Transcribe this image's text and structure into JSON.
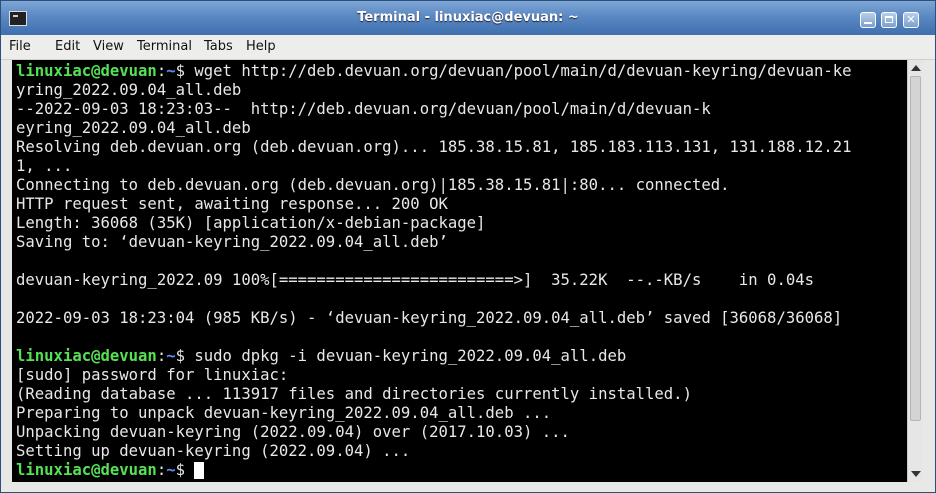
{
  "window": {
    "title": "Terminal - linuxiac@devuan: ~"
  },
  "menu": [
    "File",
    "Edit",
    "View",
    "Terminal",
    "Tabs",
    "Help"
  ],
  "colors": {
    "prompt_user": "#55e055",
    "prompt_path": "#5c8cff",
    "terminal_bg": "#000000",
    "terminal_fg": "#e8e8e8"
  },
  "prompt": {
    "user_host": "linuxiac@devuan",
    "sep": ":",
    "path": "~",
    "symbol": "$"
  },
  "terminal": {
    "cmd1": " wget http://deb.devuan.org/devuan/pool/main/d/devuan-keyring/devuan-ke",
    "out": [
      "yring_2022.09.04_all.deb",
      "--2022-09-03 18:23:03--  http://deb.devuan.org/devuan/pool/main/d/devuan-k",
      "eyring_2022.09.04_all.deb",
      "Resolving deb.devuan.org (deb.devuan.org)... 185.38.15.81, 185.183.113.131, 131.188.12.21",
      "1, ...",
      "Connecting to deb.devuan.org (deb.devuan.org)|185.38.15.81|:80... connected.",
      "HTTP request sent, awaiting response... 200 OK",
      "Length: 36068 (35K) [application/x-debian-package]",
      "Saving to: ‘devuan-keyring_2022.09.04_all.deb’",
      "",
      "devuan-keyring_2022.09 100%[=========================>]  35.22K  --.-KB/s    in 0.04s",
      "",
      "2022-09-03 18:23:04 (985 KB/s) - ‘devuan-keyring_2022.09.04_all.deb’ saved [36068/36068]",
      ""
    ],
    "cmd2": " sudo dpkg -i devuan-keyring_2022.09.04_all.deb",
    "out2": [
      "[sudo] password for linuxiac:",
      "(Reading database ... 113917 files and directories currently installed.)",
      "Preparing to unpack devuan-keyring_2022.09.04_all.deb ...",
      "Unpacking devuan-keyring (2022.09.04) over (2017.10.03) ...",
      "Setting up devuan-keyring (2022.09.04) ..."
    ],
    "cmd3": " "
  }
}
